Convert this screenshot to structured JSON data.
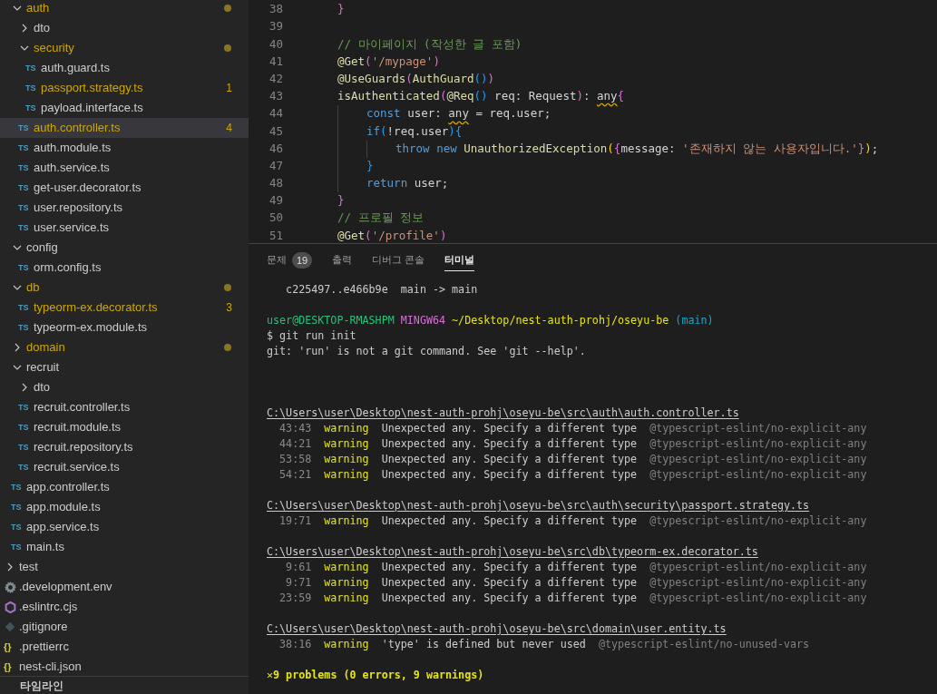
{
  "explorer": {
    "src_children": [
      {
        "name": "auth",
        "kind": "folder",
        "expanded": true,
        "selected": false,
        "modified": true,
        "children": [
          {
            "name": "dto",
            "kind": "folder",
            "expanded": false,
            "selected": false,
            "modified": false
          },
          {
            "name": "security",
            "kind": "folder",
            "expanded": true,
            "selected": false,
            "modified": true,
            "children": [
              {
                "name": "auth.guard.ts",
                "kind": "typescript",
                "icon": "TS",
                "selected": false,
                "modified": false
              },
              {
                "name": "passport.strategy.ts",
                "kind": "typescript",
                "icon": "TS",
                "selected": false,
                "modified": true,
                "badge": "1"
              },
              {
                "name": "payload.interface.ts",
                "kind": "typescript",
                "icon": "TS",
                "selected": false,
                "modified": false
              }
            ]
          },
          {
            "name": "auth.controller.ts",
            "kind": "typescript",
            "icon": "TS",
            "selected": true,
            "modified": true,
            "badge": "4"
          },
          {
            "name": "auth.module.ts",
            "kind": "typescript",
            "icon": "TS",
            "selected": false,
            "modified": false
          },
          {
            "name": "auth.service.ts",
            "kind": "typescript",
            "icon": "TS",
            "selected": false,
            "modified": false
          },
          {
            "name": "get-user.decorator.ts",
            "kind": "typescript",
            "icon": "TS",
            "selected": false,
            "modified": false
          },
          {
            "name": "user.repository.ts",
            "kind": "typescript",
            "icon": "TS",
            "selected": false,
            "modified": false
          },
          {
            "name": "user.service.ts",
            "kind": "typescript",
            "icon": "TS",
            "selected": false,
            "modified": false
          }
        ]
      },
      {
        "name": "config",
        "kind": "folder",
        "expanded": true,
        "selected": false,
        "modified": false,
        "children": [
          {
            "name": "orm.config.ts",
            "kind": "typescript",
            "icon": "TS",
            "selected": false,
            "modified": false
          }
        ]
      },
      {
        "name": "db",
        "kind": "folder",
        "expanded": true,
        "selected": false,
        "modified": true,
        "children": [
          {
            "name": "typeorm-ex.decorator.ts",
            "kind": "typescript",
            "icon": "TS",
            "selected": false,
            "modified": true,
            "badge": "3"
          },
          {
            "name": "typeorm-ex.module.ts",
            "kind": "typescript",
            "icon": "TS",
            "selected": false,
            "modified": false
          }
        ]
      },
      {
        "name": "domain",
        "kind": "folder",
        "expanded": false,
        "selected": false,
        "modified": true
      },
      {
        "name": "recruit",
        "kind": "folder",
        "expanded": true,
        "selected": false,
        "modified": false,
        "children": [
          {
            "name": "dto",
            "kind": "folder",
            "expanded": false,
            "selected": false,
            "modified": false
          },
          {
            "name": "recruit.controller.ts",
            "kind": "typescript",
            "icon": "TS",
            "selected": false,
            "modified": false
          },
          {
            "name": "recruit.module.ts",
            "kind": "typescript",
            "icon": "TS",
            "selected": false,
            "modified": false
          },
          {
            "name": "recruit.repository.ts",
            "kind": "typescript",
            "icon": "TS",
            "selected": false,
            "modified": false
          },
          {
            "name": "recruit.service.ts",
            "kind": "typescript",
            "icon": "TS",
            "selected": false,
            "modified": false
          }
        ]
      },
      {
        "name": "app.controller.ts",
        "kind": "typescript",
        "icon": "TS",
        "selected": false,
        "modified": false
      },
      {
        "name": "app.module.ts",
        "kind": "typescript",
        "icon": "TS",
        "selected": false,
        "modified": false
      },
      {
        "name": "app.service.ts",
        "kind": "typescript",
        "icon": "TS",
        "selected": false,
        "modified": false
      },
      {
        "name": "main.ts",
        "kind": "typescript",
        "icon": "TS",
        "selected": false,
        "modified": false
      }
    ],
    "root_items": [
      {
        "name": "test",
        "kind": "folder",
        "expanded": false,
        "selected": false,
        "modified": false
      },
      {
        "name": ".development.env",
        "kind": "gear",
        "selected": false,
        "modified": false
      },
      {
        "name": ".eslintrc.cjs",
        "kind": "hexagon",
        "selected": false,
        "modified": false
      },
      {
        "name": ".gitignore",
        "kind": "diamond",
        "selected": false,
        "modified": false
      },
      {
        "name": ".prettierrc",
        "kind": "braces",
        "icon": "{}",
        "selected": false,
        "modified": false
      },
      {
        "name": "nest-cli.json",
        "kind": "braces",
        "icon": "{}",
        "selected": false,
        "modified": false
      }
    ],
    "timeline_title": "타임라인"
  },
  "editor": {
    "lines": [
      {
        "number": "38",
        "tokens": [
          {
            "text": "}",
            "kind": "b1"
          }
        ]
      },
      {
        "number": "39"
      },
      {
        "number": "40",
        "tokens": [
          {
            "text": "// 마이페이지 (작성한 글 포함)",
            "kind": "cmt"
          }
        ]
      },
      {
        "number": "41",
        "tokens": [
          {
            "text": "@Get",
            "kind": "fn"
          },
          {
            "text": "(",
            "kind": "b1"
          },
          {
            "text": "'/mypage'",
            "kind": "str"
          },
          {
            "text": ")",
            "kind": "b1"
          }
        ]
      },
      {
        "number": "42",
        "tokens": [
          {
            "text": "@UseGuards",
            "kind": "fn"
          },
          {
            "text": "(",
            "kind": "b1"
          },
          {
            "text": "AuthGuard",
            "kind": "fn"
          },
          {
            "text": "()",
            "kind": "b2"
          },
          {
            "text": ")",
            "kind": "b1"
          }
        ]
      },
      {
        "number": "43",
        "tokens": [
          {
            "text": "isAuthenticated",
            "kind": "fn"
          },
          {
            "text": "(",
            "kind": "b1"
          },
          {
            "text": "@Req",
            "kind": "fn"
          },
          {
            "text": "()",
            "kind": "b2"
          },
          {
            "text": " req: Request",
            "kind": "plain"
          },
          {
            "text": ")",
            "kind": "b1"
          },
          {
            "text": ": ",
            "kind": "plain"
          },
          {
            "text": "any",
            "kind": "plain",
            "squiggle": true
          },
          {
            "text": "{",
            "kind": "b1"
          }
        ],
        "children": [
          {
            "number": "44",
            "tokens": [
              {
                "text": "const",
                "kind": "kw"
              },
              {
                "text": " user: ",
                "kind": "plain"
              },
              {
                "text": "any",
                "kind": "plain",
                "squiggle": true
              },
              {
                "text": " = req.user;",
                "kind": "plain"
              }
            ]
          },
          {
            "number": "45",
            "tokens": [
              {
                "text": "if",
                "kind": "kw"
              },
              {
                "text": "(",
                "kind": "b2"
              },
              {
                "text": "!req.user",
                "kind": "plain"
              },
              {
                "text": ")",
                "kind": "b2"
              },
              {
                "text": "{",
                "kind": "b2"
              }
            ],
            "children": [
              {
                "number": "46",
                "tokens": [
                  {
                    "text": "throw new",
                    "kind": "kw"
                  },
                  {
                    "text": " UnauthorizedException",
                    "kind": "fn"
                  },
                  {
                    "text": "(",
                    "kind": "b3"
                  },
                  {
                    "text": "{",
                    "kind": "b1"
                  },
                  {
                    "text": "message: ",
                    "kind": "plain"
                  },
                  {
                    "text": "'존재하지 않는 사용자입니다.'",
                    "kind": "str"
                  },
                  {
                    "text": "}",
                    "kind": "b1"
                  },
                  {
                    "text": ")",
                    "kind": "b3"
                  },
                  {
                    "text": ";",
                    "kind": "plain"
                  }
                ]
              }
            ]
          },
          {
            "number": "47",
            "tokens": [
              {
                "text": "}",
                "kind": "b2"
              }
            ]
          },
          {
            "number": "48",
            "tokens": [
              {
                "text": "return",
                "kind": "kw"
              },
              {
                "text": " user;",
                "kind": "plain"
              }
            ]
          }
        ]
      },
      {
        "number": "49",
        "tokens": [
          {
            "text": "}",
            "kind": "b1"
          }
        ]
      },
      {
        "number": "50",
        "tokens": [
          {
            "text": "// 프로필 정보",
            "kind": "cmt"
          }
        ]
      },
      {
        "number": "51",
        "tokens": [
          {
            "text": "@Get",
            "kind": "fn"
          },
          {
            "text": "(",
            "kind": "b1"
          },
          {
            "text": "'/profile'",
            "kind": "str"
          },
          {
            "text": ")",
            "kind": "b1"
          }
        ]
      }
    ]
  },
  "panel": {
    "tabs": [
      {
        "label": "문제",
        "badge": "19",
        "selected": false
      },
      {
        "label": "출력",
        "selected": false
      },
      {
        "label": "디버그 콘솔",
        "selected": false
      },
      {
        "label": "터미널",
        "selected": true
      }
    ],
    "terminal": [
      {
        "kind": "ref",
        "text": "c225497..e466b9e  main -> main"
      },
      {
        "kind": "blank"
      },
      {
        "kind": "prompt",
        "segments": [
          {
            "text": "user@DESKTOP-RMASHPM",
            "color": "#23c07a"
          },
          {
            "text": "MINGW64",
            "color": "#d670d6"
          },
          {
            "text": "~/Desktop/nest-auth-prohj/oseyu-be",
            "color": "#e5e510"
          },
          {
            "text": "(main)",
            "color": "#11a8cd"
          }
        ]
      },
      {
        "kind": "text",
        "text": "$ git run init"
      },
      {
        "kind": "text",
        "text": "git: 'run' is not a git command. See 'git --help'."
      },
      {
        "kind": "blank"
      },
      {
        "kind": "blank"
      },
      {
        "kind": "blank"
      },
      {
        "kind": "path",
        "text": "C:\\Users\\user\\Desktop\\nest-auth-prohj\\oseyu-be\\src\\auth\\auth.controller.ts"
      },
      {
        "kind": "warning",
        "position": "43:43",
        "level": "warning",
        "message": "Unexpected any. Specify a different type",
        "rule": "@typescript-eslint/no-explicit-any"
      },
      {
        "kind": "warning",
        "position": "44:21",
        "level": "warning",
        "message": "Unexpected any. Specify a different type",
        "rule": "@typescript-eslint/no-explicit-any"
      },
      {
        "kind": "warning",
        "position": "53:58",
        "level": "warning",
        "message": "Unexpected any. Specify a different type",
        "rule": "@typescript-eslint/no-explicit-any"
      },
      {
        "kind": "warning",
        "position": "54:21",
        "level": "warning",
        "message": "Unexpected any. Specify a different type",
        "rule": "@typescript-eslint/no-explicit-any"
      },
      {
        "kind": "blank"
      },
      {
        "kind": "path",
        "text": "C:\\Users\\user\\Desktop\\nest-auth-prohj\\oseyu-be\\src\\auth\\security\\passport.strategy.ts"
      },
      {
        "kind": "warning",
        "position": "19:71",
        "level": "warning",
        "message": "Unexpected any. Specify a different type",
        "rule": "@typescript-eslint/no-explicit-any"
      },
      {
        "kind": "blank"
      },
      {
        "kind": "path",
        "text": "C:\\Users\\user\\Desktop\\nest-auth-prohj\\oseyu-be\\src\\db\\typeorm-ex.decorator.ts"
      },
      {
        "kind": "warning",
        "position": "9:61",
        "level": "warning",
        "message": "Unexpected any. Specify a different type",
        "rule": "@typescript-eslint/no-explicit-any"
      },
      {
        "kind": "warning",
        "position": "9:71",
        "level": "warning",
        "message": "Unexpected any. Specify a different type",
        "rule": "@typescript-eslint/no-explicit-any"
      },
      {
        "kind": "warning",
        "position": "23:59",
        "level": "warning",
        "message": "Unexpected any. Specify a different type",
        "rule": "@typescript-eslint/no-explicit-any"
      },
      {
        "kind": "blank"
      },
      {
        "kind": "path",
        "text": "C:\\Users\\user\\Desktop\\nest-auth-prohj\\oseyu-be\\src\\domain\\user.entity.ts"
      },
      {
        "kind": "warning",
        "position": "38:16",
        "level": "warning",
        "message": "'type' is defined but never used",
        "rule": "@typescript-eslint/no-unused-vars"
      },
      {
        "kind": "blank"
      },
      {
        "kind": "summary",
        "icon": "✕",
        "text": "9 problems (0 errors, 9 warnings)"
      }
    ]
  }
}
